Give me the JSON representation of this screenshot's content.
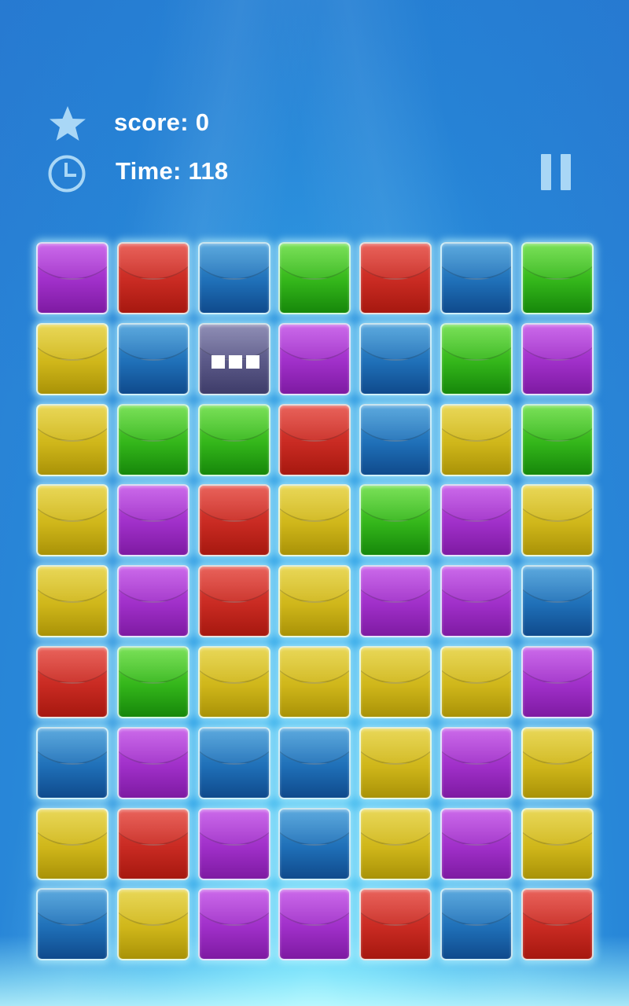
{
  "hud": {
    "score_label": "score: 0",
    "time_label": "Time: 118",
    "star_icon": "star-icon",
    "clock_icon": "clock-icon",
    "pause_icon": "pause-icon"
  },
  "colors": {
    "purple": "#a533cf",
    "red": "#cc2e25",
    "blue": "#1f6fb7",
    "green": "#36b81c",
    "yellow": "#cfb61a",
    "special": "#5a5887",
    "icon": "#a9d7f6"
  },
  "board": {
    "columns": 7,
    "rows": 9,
    "grid": [
      [
        "purple",
        "red",
        "blue",
        "green",
        "red",
        "blue",
        "green"
      ],
      [
        "yellow",
        "blue",
        "special",
        "purple",
        "blue",
        "green",
        "purple"
      ],
      [
        "yellow",
        "green",
        "green",
        "red",
        "blue",
        "yellow",
        "green"
      ],
      [
        "yellow",
        "purple",
        "red",
        "yellow",
        "green",
        "purple",
        "yellow"
      ],
      [
        "yellow",
        "purple",
        "red",
        "yellow",
        "purple",
        "purple",
        "blue"
      ],
      [
        "red",
        "green",
        "yellow",
        "yellow",
        "yellow",
        "yellow",
        "purple"
      ],
      [
        "blue",
        "purple",
        "blue",
        "blue",
        "yellow",
        "purple",
        "yellow"
      ],
      [
        "yellow",
        "red",
        "purple",
        "blue",
        "yellow",
        "purple",
        "yellow"
      ],
      [
        "blue",
        "yellow",
        "purple",
        "purple",
        "red",
        "blue",
        "red"
      ]
    ],
    "special_tile_icon": "ellipsis-icon"
  }
}
